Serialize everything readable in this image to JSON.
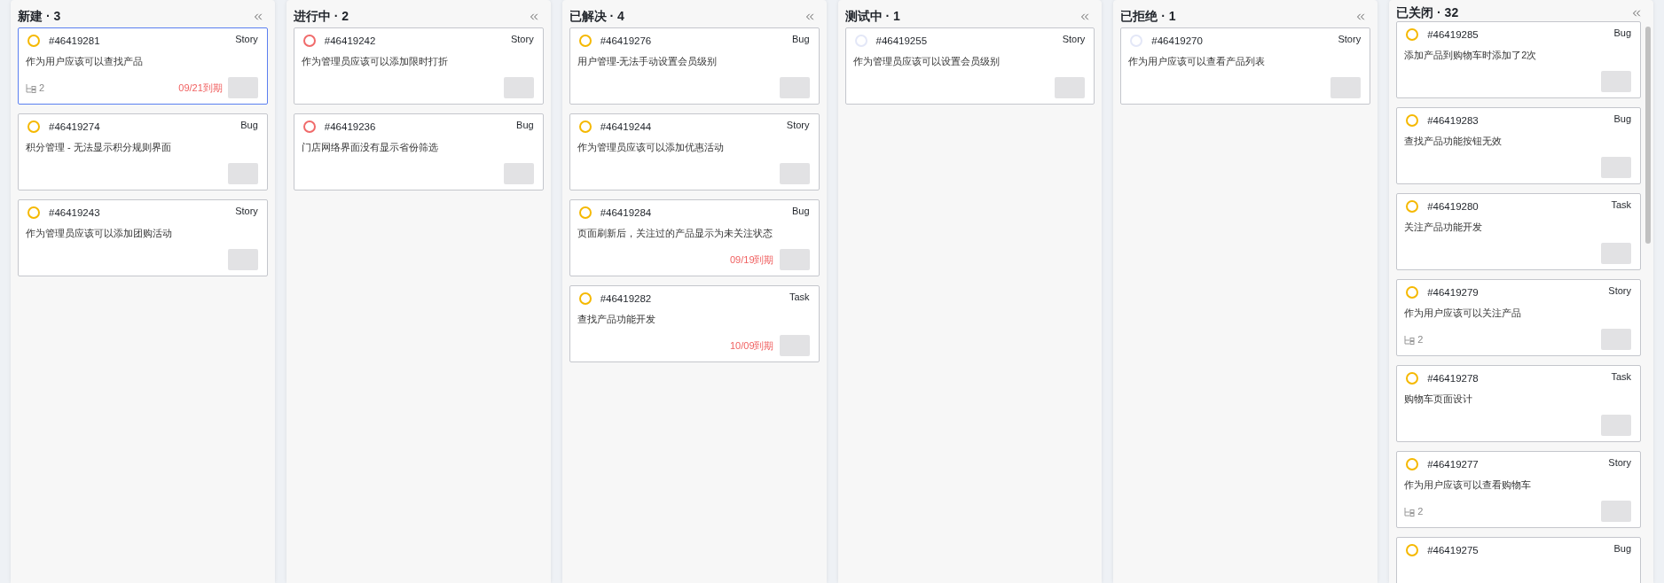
{
  "columns": [
    {
      "title": "新建 · 3",
      "cards": [
        {
          "id": "#46419281",
          "type": "Story",
          "color": "#f5b800",
          "selected": true,
          "description": "作为用户应该可以查找产品",
          "subtasks": "2",
          "due": "09/21到期"
        },
        {
          "id": "#46419274",
          "type": "Bug",
          "color": "#f5b800",
          "selected": false,
          "description": "积分管理 - 无法显示积分规则界面"
        },
        {
          "id": "#46419243",
          "type": "Story",
          "color": "#f5b800",
          "selected": false,
          "description": "作为管理员应该可以添加团购活动"
        }
      ]
    },
    {
      "title": "进行中 · 2",
      "cards": [
        {
          "id": "#46419242",
          "type": "Story",
          "color": "#f06a6a",
          "selected": false,
          "description": "作为管理员应该可以添加限时打折"
        },
        {
          "id": "#46419236",
          "type": "Bug",
          "color": "#f06a6a",
          "selected": false,
          "description": "门店网络界面没有显示省份筛选"
        }
      ]
    },
    {
      "title": "已解决 · 4",
      "cards": [
        {
          "id": "#46419276",
          "type": "Bug",
          "color": "#f5b800",
          "selected": false,
          "description": "用户管理-无法手动设置会员级别"
        },
        {
          "id": "#46419244",
          "type": "Story",
          "color": "#f5b800",
          "selected": false,
          "description": "作为管理员应该可以添加优惠活动"
        },
        {
          "id": "#46419284",
          "type": "Bug",
          "color": "#f5b800",
          "selected": false,
          "description": "页面刷新后，关注过的产品显示为未关注状态",
          "due": "09/19到期"
        },
        {
          "id": "#46419282",
          "type": "Task",
          "color": "#f5b800",
          "selected": false,
          "description": "查找产品功能开发",
          "due": "10/09到期"
        }
      ]
    },
    {
      "title": "测试中 · 1",
      "cards": [
        {
          "id": "#46419255",
          "type": "Story",
          "color": "#e3e7f7",
          "selected": false,
          "description": "作为管理员应该可以设置会员级别"
        }
      ]
    },
    {
      "title": "已拒绝 · 1",
      "cards": [
        {
          "id": "#46419270",
          "type": "Story",
          "color": "#e3e7f7",
          "selected": false,
          "description": "作为用户应该可以查看产品列表"
        }
      ]
    },
    {
      "title": "已关闭 · 32",
      "cards": [
        {
          "id": "#46419285",
          "type": "Bug",
          "color": "#f5b800",
          "selected": false,
          "description": "添加产品到购物车时添加了2次"
        },
        {
          "id": "#46419283",
          "type": "Bug",
          "color": "#f5b800",
          "selected": false,
          "description": "查找产品功能按钮无效"
        },
        {
          "id": "#46419280",
          "type": "Task",
          "color": "#f5b800",
          "selected": false,
          "description": "关注产品功能开发"
        },
        {
          "id": "#46419279",
          "type": "Story",
          "color": "#f5b800",
          "selected": false,
          "description": "作为用户应该可以关注产品",
          "subtasks": "2"
        },
        {
          "id": "#46419278",
          "type": "Task",
          "color": "#f5b800",
          "selected": false,
          "description": "购物车页面设计"
        },
        {
          "id": "#46419277",
          "type": "Story",
          "color": "#f5b800",
          "selected": false,
          "description": "作为用户应该可以查看购物车",
          "subtasks": "2"
        },
        {
          "id": "#46419275",
          "type": "Bug",
          "color": "#f5b800",
          "selected": false
        }
      ]
    }
  ]
}
